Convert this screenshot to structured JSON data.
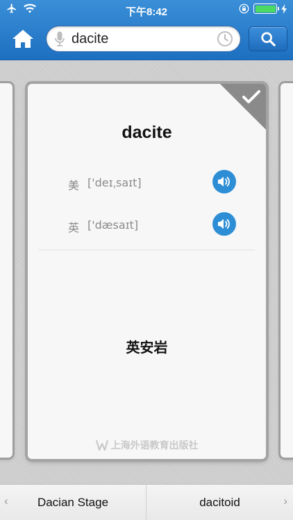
{
  "status_bar": {
    "time": "下午8:42"
  },
  "search": {
    "value": "dacite"
  },
  "card": {
    "word": "dacite",
    "pronunciations": [
      {
        "label": "美",
        "ipa": "['deɪˌsaɪt]"
      },
      {
        "label": "英",
        "ipa": "['dæsaɪt]"
      }
    ],
    "definition": "英安岩",
    "publisher": "上海外语教育出版社"
  },
  "bottom_nav": {
    "prev_label": "Dacian Stage",
    "next_label": "dacitoid",
    "prev_arrow": "‹",
    "next_arrow": "›"
  },
  "colors": {
    "header_blue": "#1d6fc0",
    "speaker_blue": "#2d8ed6",
    "battery_green": "#4cd964"
  }
}
